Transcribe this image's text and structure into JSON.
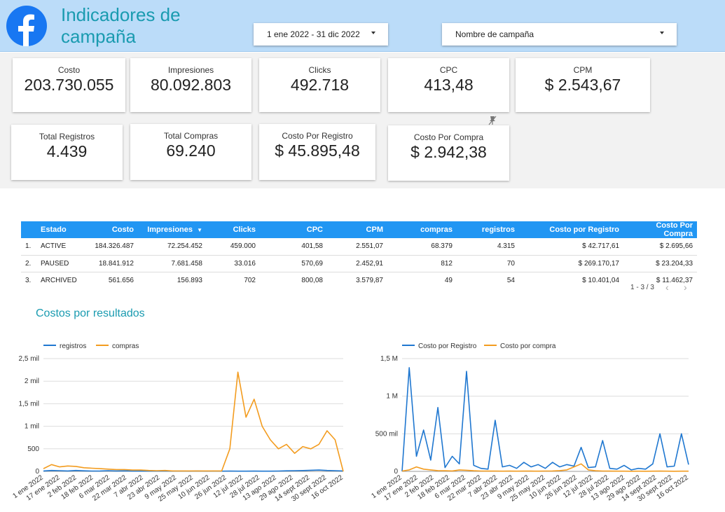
{
  "header": {
    "title": "Indicadores de campaña",
    "logo_icon": "facebook-icon",
    "date_range": "1 ene 2022 - 31 dic 2022",
    "campaign_filter": "Nombre de campaña"
  },
  "kpis": [
    {
      "label": "Costo",
      "value": "203.730.055"
    },
    {
      "label": "Impresiones",
      "value": "80.092.803"
    },
    {
      "label": "Clicks",
      "value": "492.718"
    },
    {
      "label": "CPC",
      "value": "413,48"
    },
    {
      "label": "CPM",
      "value": "$ 2.543,67"
    },
    {
      "label": "Total Registros",
      "value": "4.439"
    },
    {
      "label": "Total Compras",
      "value": "69.240"
    },
    {
      "label": "Costo Por Registro",
      "value": "$ 45.895,48"
    },
    {
      "label": "Costo Por Compra",
      "value": "$ 2.942,38"
    }
  ],
  "table": {
    "columns": [
      "Estado",
      "Costo",
      "Impresiones",
      "Clicks",
      "CPC",
      "CPM",
      "compras",
      "registros",
      "Costo por Registro",
      "Costo Por Compra"
    ],
    "sort_icon": "sort-down-icon",
    "rows": [
      [
        "1.",
        "ACTIVE",
        "184.326.487",
        "72.254.452",
        "459.000",
        "401,58",
        "2.551,07",
        "68.379",
        "4.315",
        "$ 42.717,61",
        "$ 2.695,66"
      ],
      [
        "2.",
        "PAUSED",
        "18.841.912",
        "7.681.458",
        "33.016",
        "570,69",
        "2.452,91",
        "812",
        "70",
        "$ 269.170,17",
        "$ 23.204,33"
      ],
      [
        "3.",
        "ARCHIVED",
        "561.656",
        "156.893",
        "702",
        "800,08",
        "3.579,87",
        "49",
        "54",
        "$ 10.401,04",
        "$ 11.462,37"
      ]
    ],
    "pager": "1 - 3 / 3",
    "prev": "‹",
    "next": "›"
  },
  "section_title": "Costos por resultados",
  "colors": {
    "blue": "#1f77d0",
    "orange": "#f39c1f",
    "header_bg": "#bbdcf9",
    "title": "#1a9bb0"
  },
  "chart_data": [
    {
      "type": "line",
      "series": [
        {
          "name": "registros",
          "color": "#1f77d0",
          "values": [
            10,
            20,
            15,
            10,
            20,
            12,
            8,
            10,
            15,
            10,
            12,
            8,
            10,
            6,
            8,
            10,
            6,
            8,
            5,
            10,
            5,
            6,
            4,
            8,
            5,
            4,
            6,
            5,
            5,
            8,
            12,
            15,
            18,
            25,
            30,
            20,
            15,
            10
          ]
        },
        {
          "name": "compras",
          "color": "#f39c1f",
          "values": [
            60,
            150,
            100,
            120,
            110,
            80,
            70,
            60,
            50,
            40,
            40,
            30,
            30,
            20,
            15,
            20,
            10,
            10,
            10,
            10,
            10,
            10,
            10,
            500,
            2200,
            1200,
            1600,
            1000,
            700,
            500,
            600,
            400,
            550,
            500,
            600,
            900,
            700,
            0
          ]
        }
      ],
      "x_ticks": [
        "1 ene 2022",
        "17 ene 2022",
        "2 feb 2022",
        "18 feb 2022",
        "6 mar 2022",
        "22 mar 2022",
        "7 abr 2022",
        "23 abr 2022",
        "9 may 2022",
        "25 may 2022",
        "10 jun 2022",
        "26 jun 2022",
        "12 jul 2022",
        "28 jul 2022",
        "13 ago 2022",
        "29 ago 2022",
        "14 sept 2022",
        "30 sept 2022",
        "16 oct 2022"
      ],
      "y_ticks": [
        "0",
        "500",
        "1 mil",
        "1,5 mil",
        "2 mil",
        "2,5 mil"
      ],
      "ylim": [
        0,
        2500
      ],
      "legend": "top-left"
    },
    {
      "type": "line",
      "series": [
        {
          "name": "Costo por Registro",
          "color": "#1f77d0",
          "values": [
            0,
            1380000,
            200000,
            550000,
            150000,
            850000,
            50000,
            200000,
            100000,
            1330000,
            80000,
            40000,
            30000,
            680000,
            60000,
            80000,
            40000,
            120000,
            60000,
            90000,
            40000,
            120000,
            60000,
            90000,
            70000,
            320000,
            50000,
            60000,
            410000,
            40000,
            30000,
            80000,
            20000,
            40000,
            30000,
            100000,
            500000,
            60000,
            70000,
            500000,
            90000
          ]
        },
        {
          "name": "Costo por compra",
          "color": "#f39c1f",
          "values": [
            5000,
            20000,
            60000,
            30000,
            20000,
            10000,
            8000,
            6000,
            20000,
            15000,
            8000,
            5000,
            4000,
            5000,
            3000,
            4000,
            3000,
            5000,
            4000,
            3000,
            5000,
            6000,
            10000,
            20000,
            60000,
            100000,
            20000,
            8000,
            5000,
            4000,
            3000,
            3000,
            2000,
            3000,
            2000,
            3000,
            4000,
            3000,
            2000,
            3000,
            3000
          ]
        }
      ],
      "x_ticks": [
        "1 ene 2022",
        "17 ene 2022",
        "2 feb 2022",
        "18 feb 2022",
        "6 mar 2022",
        "22 mar 2022",
        "7 abr 2022",
        "23 abr 2022",
        "9 may 2022",
        "25 may 2022",
        "10 jun 2022",
        "26 jun 2022",
        "12 jul 2022",
        "28 jul 2022",
        "13 ago 2022",
        "29 ago 2022",
        "14 sept 2022",
        "30 sept 2022",
        "16 oct 2022"
      ],
      "y_ticks": [
        "0",
        "500 mil",
        "1 M",
        "1,5 M"
      ],
      "ylim": [
        0,
        1500000
      ],
      "legend": "top-left"
    }
  ]
}
